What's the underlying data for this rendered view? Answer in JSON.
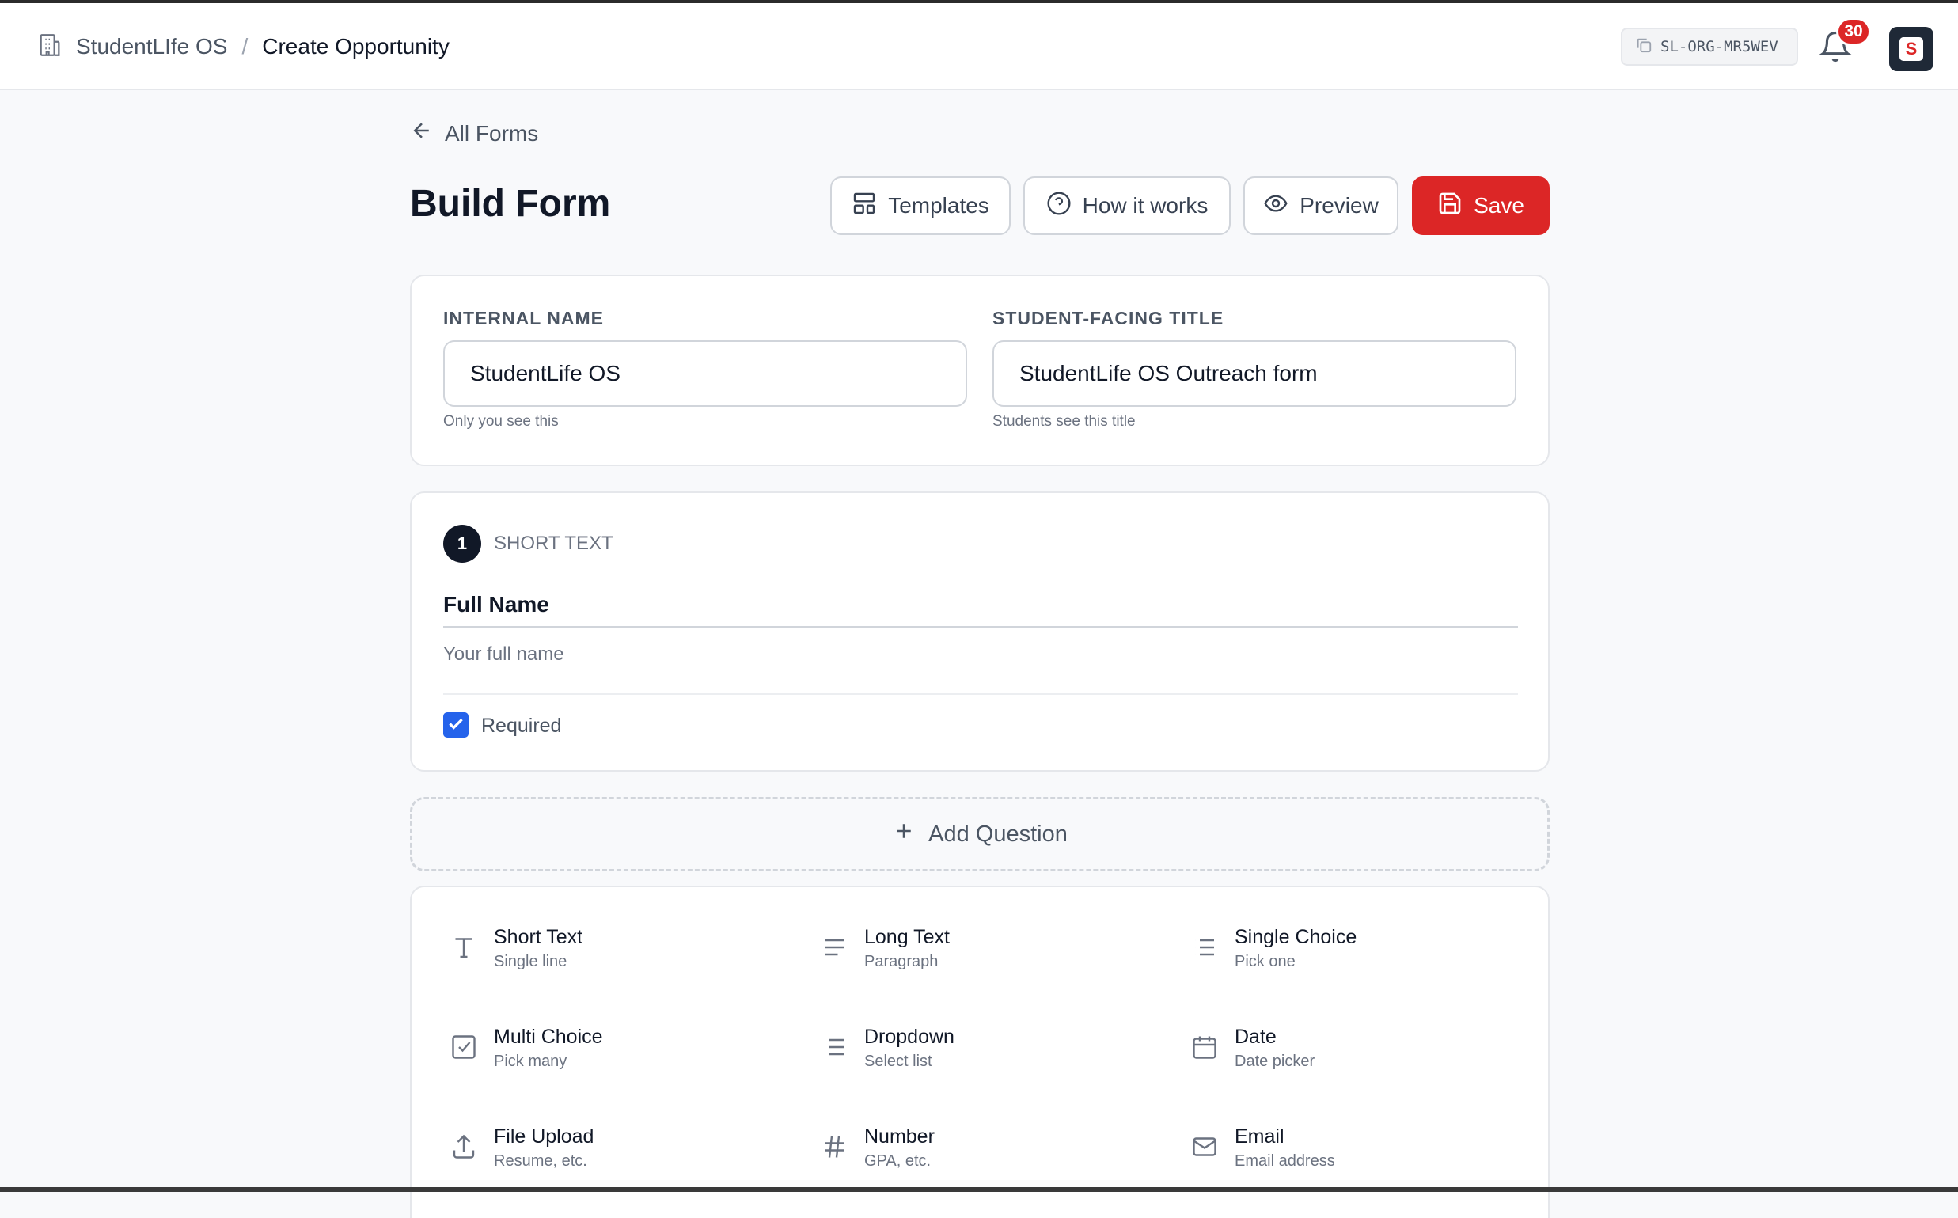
{
  "header": {
    "org_name": "StudentLIfe OS",
    "separator": "/",
    "page_title": "Create Opportunity",
    "org_code": "SL-ORG-MR5WEV",
    "notification_count": "30",
    "avatar_letter": "S"
  },
  "back_link": "All Forms",
  "page": {
    "title": "Build Form"
  },
  "toolbar": {
    "templates": "Templates",
    "how_it_works": "How it works",
    "preview": "Preview",
    "save": "Save"
  },
  "names": {
    "internal_label": "INTERNAL NAME",
    "internal_value": "StudentLife OS",
    "internal_hint": "Only you see this",
    "title_label": "STUDENT-FACING TITLE",
    "title_value": "StudentLife OS Outreach form",
    "title_hint": "Students see this title"
  },
  "question": {
    "number": "1",
    "type": "SHORT TEXT",
    "label": "Full Name",
    "placeholder": "Your full name",
    "required_label": "Required",
    "required": true
  },
  "add_question": "Add Question",
  "question_types": [
    {
      "label": "Short Text",
      "sub": "Single line",
      "icon": "text-icon"
    },
    {
      "label": "Long Text",
      "sub": "Paragraph",
      "icon": "paragraph-icon"
    },
    {
      "label": "Single Choice",
      "sub": "Pick one",
      "icon": "list-icon"
    },
    {
      "label": "Multi Choice",
      "sub": "Pick many",
      "icon": "checkbox-icon"
    },
    {
      "label": "Dropdown",
      "sub": "Select list",
      "icon": "list-icon"
    },
    {
      "label": "Date",
      "sub": "Date picker",
      "icon": "calendar-icon"
    },
    {
      "label": "File Upload",
      "sub": "Resume, etc.",
      "icon": "upload-icon"
    },
    {
      "label": "Number",
      "sub": "GPA, etc.",
      "icon": "hash-icon"
    },
    {
      "label": "Email",
      "sub": "Email address",
      "icon": "mail-icon"
    }
  ],
  "colors": {
    "accent_red": "#dc2626",
    "checkbox_blue": "#2563eb",
    "dark": "#111827"
  }
}
